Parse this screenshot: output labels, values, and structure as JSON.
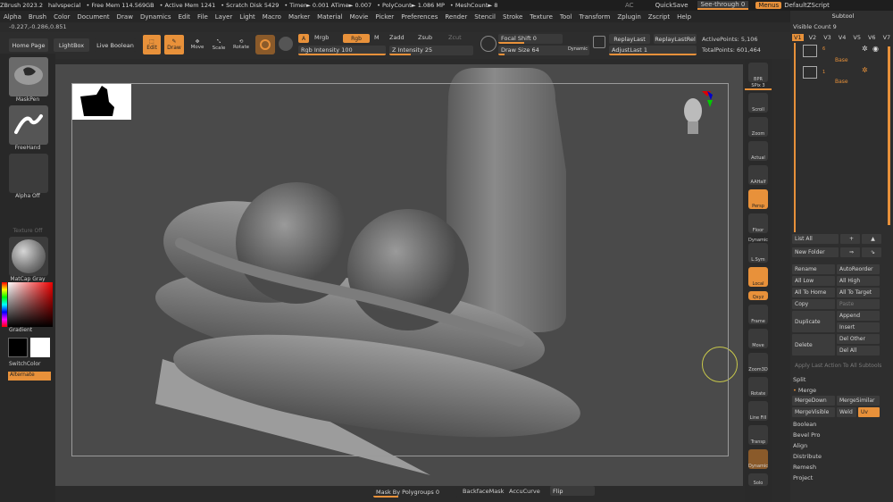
{
  "titlebar": {
    "app": "ZBrush 2023.2",
    "project": "halvspecial",
    "free_mem": "• Free Mem 114.569GB",
    "active_mem": "• Active Mem 1241",
    "scratch": "• Scratch Disk 5429",
    "timer": "• Timer► 0.001 ATime► 0.007",
    "polycount": "• PolyCount► 1.086 MP",
    "meshcount": "• MeshCount► 8",
    "ac": "AC",
    "quicksave": "QuickSave",
    "seethrough": "See-through  0",
    "menus": "Menus",
    "script": "DefaultZScript"
  },
  "menubar": [
    "Alpha",
    "Brush",
    "Color",
    "Document",
    "Draw",
    "Dynamics",
    "Edit",
    "File",
    "Layer",
    "Light",
    "Macro",
    "Marker",
    "Material",
    "Movie",
    "Picker",
    "Preferences",
    "Render",
    "Stencil",
    "Stroke",
    "Texture",
    "Tool",
    "Transform",
    "Zplugin",
    "Zscript",
    "Help"
  ],
  "coords": "-0.227,-0.286,0.851",
  "toolbar": {
    "home_page": "Home Page",
    "lightbox": "LightBox",
    "live_boolean": "Live Boolean",
    "edit": "Edit",
    "draw": "Draw",
    "move": "Move",
    "scale": "Scale",
    "rotate": "Rotate",
    "a": "A",
    "mrgb": "Mrgb",
    "rgb": "Rgb",
    "m": "M",
    "zadd": "Zadd",
    "zsub": "Zsub",
    "zcut": "Zcut",
    "rgb_intensity": "Rgb Intensity 100",
    "z_intensity": "Z Intensity 25",
    "focal_shift": "Focal Shift 0",
    "draw_size": "Draw Size 64",
    "dynamic": "Dynamic",
    "replay_last": "ReplayLast",
    "replay_last_rel": "ReplayLastRel",
    "adjust_last": "AdjustLast  1",
    "active_points": "ActivePoints: 5,106",
    "total_points": "TotalPoints: 601,464",
    "rgb_intensity_value": 100,
    "z_intensity_value": 25,
    "draw_size_value": 64
  },
  "leftpanel": {
    "brush": "MaskPen",
    "stroke": "FreeHand",
    "alpha": "Alpha Off",
    "texture": "Texture Off",
    "material": "MatCap Gray",
    "gradient": "Gradient",
    "switchcolor": "SwitchColor",
    "alternate": "Alternate"
  },
  "righttools": {
    "bpr": "BPR",
    "spix": "SPix 3",
    "scroll": "Scroll",
    "zoom": "Zoom",
    "actual": "Actual",
    "aahalf": "AAHalf",
    "persp": "Persp",
    "floor": "Floor",
    "dynamic": "Dynamic",
    "l_sym": "L.Sym",
    "local": "Local",
    "xyz": "Qxyz",
    "frame": "Frame",
    "move": "Move",
    "zoom3d": "Zoom3D",
    "rotate": "Rotate",
    "linefill": "Line Fill",
    "polyf": "PolyF",
    "transp": "Transp",
    "dynamesh": "Dynamic",
    "solo": "Solo",
    "xpose": "Xpose"
  },
  "subtool": {
    "title": "Subtool",
    "visible_count": "Visible Count 9",
    "versions": [
      "V1",
      "V2",
      "V3",
      "V4",
      "V5",
      "V6",
      "V7",
      "V8"
    ],
    "items": [
      {
        "label": "Base",
        "num": "6"
      },
      {
        "label": "Base",
        "num": "1"
      }
    ],
    "list_all": "List All",
    "new_folder": "New Folder",
    "rename": "Rename",
    "autoreorder": "AutoReorder",
    "all_low": "All Low",
    "all_high": "All High",
    "all_to_home": "All To Home",
    "all_to_target": "All To Target",
    "copy": "Copy",
    "paste": "Paste",
    "duplicate": "Duplicate",
    "append": "Append",
    "insert": "Insert",
    "delete": "Delete",
    "del_other": "Del Other",
    "del_all": "Del All",
    "apply_last": "Apply Last Action To All Subtools",
    "split": "Split",
    "merge": "Merge",
    "mergedown": "MergeDown",
    "mergesimilar": "MergeSimilar",
    "mergevisible": "MergeVisible",
    "weld": "Weld",
    "uv": "Uv",
    "boolean": "Boolean",
    "bevel_pro": "Bevel Pro",
    "align": "Align",
    "distribute": "Distribute",
    "remesh": "Remesh",
    "project": "Project"
  },
  "bottombar": {
    "mask_by_polygroups": "Mask By Polygroups 0",
    "backface_mask": "BackfaceMask",
    "accucurve": "AccuCurve",
    "flip": "Flip"
  },
  "colors": {
    "accent": "#e8913a",
    "viewport_bg": "#4a4a4a",
    "panel_bg": "#2b2b2b"
  }
}
